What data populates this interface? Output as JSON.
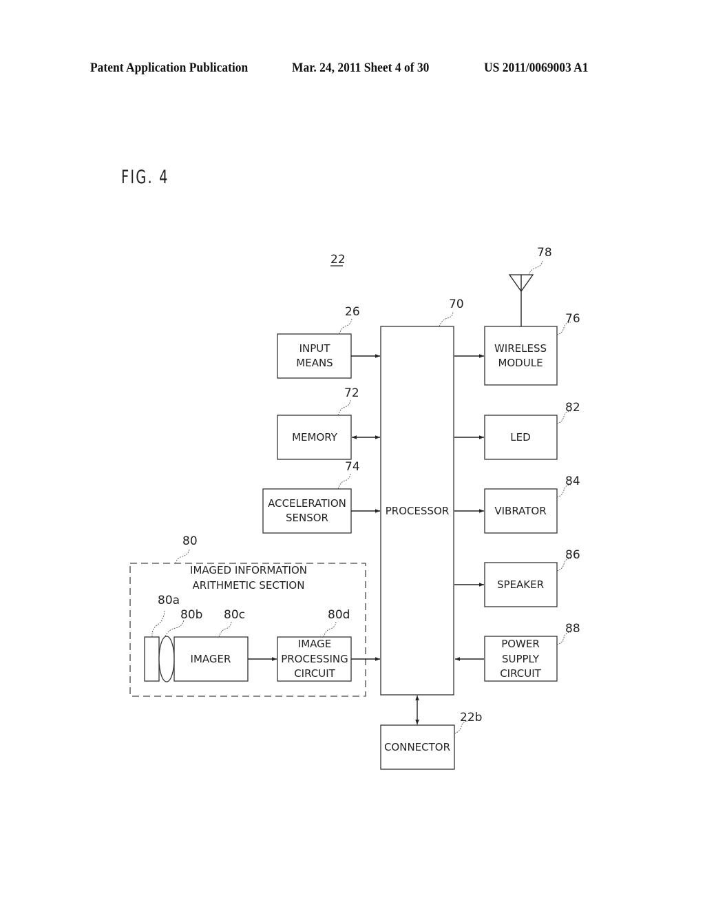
{
  "header": {
    "publication": "Patent Application Publication",
    "date_sheet": "Mar. 24, 2011  Sheet 4 of 30",
    "patent_number": "US 2011/0069003 A1"
  },
  "figure": {
    "title": "FIG. 4",
    "device_ref": "22"
  },
  "blocks": {
    "input_means": {
      "lines": [
        "INPUT",
        "MEANS"
      ],
      "ref": "26"
    },
    "memory": {
      "lines": [
        "MEMORY"
      ],
      "ref": "72"
    },
    "acceleration_sensor": {
      "lines": [
        "ACCELERATION",
        "SENSOR"
      ],
      "ref": "74"
    },
    "processor": {
      "lines": [
        "PROCESSOR"
      ],
      "ref": "70"
    },
    "wireless_module": {
      "lines": [
        "WIRELESS",
        "MODULE"
      ],
      "ref": "76"
    },
    "antenna": {
      "ref": "78"
    },
    "led": {
      "lines": [
        "LED"
      ],
      "ref": "82"
    },
    "vibrator": {
      "lines": [
        "VIBRATOR"
      ],
      "ref": "84"
    },
    "speaker": {
      "lines": [
        "SPEAKER"
      ],
      "ref": "86"
    },
    "power_supply_circuit": {
      "lines": [
        "POWER",
        "SUPPLY",
        "CIRCUIT"
      ],
      "ref": "88"
    },
    "connector": {
      "lines": [
        "CONNECTOR"
      ],
      "ref": "22b"
    },
    "imaged_info_section": {
      "lines": [
        "IMAGED INFORMATION",
        "ARITHMETIC SECTION"
      ],
      "ref": "80"
    },
    "filter": {
      "ref": "80a"
    },
    "lens": {
      "ref": "80b"
    },
    "imager": {
      "lines": [
        "IMAGER"
      ],
      "ref": "80c"
    },
    "image_processing_circuit": {
      "lines": [
        "IMAGE",
        "PROCESSING",
        "CIRCUIT"
      ],
      "ref": "80d"
    }
  },
  "connections": [
    {
      "from": "input_means",
      "to": "processor",
      "direction": "one-way"
    },
    {
      "from": "memory",
      "to": "processor",
      "direction": "two-way"
    },
    {
      "from": "acceleration_sensor",
      "to": "processor",
      "direction": "one-way"
    },
    {
      "from": "image_processing_circuit",
      "to": "processor",
      "direction": "one-way"
    },
    {
      "from": "imager",
      "to": "image_processing_circuit",
      "direction": "one-way"
    },
    {
      "from": "processor",
      "to": "wireless_module",
      "direction": "one-way"
    },
    {
      "from": "processor",
      "to": "led",
      "direction": "one-way"
    },
    {
      "from": "processor",
      "to": "vibrator",
      "direction": "one-way"
    },
    {
      "from": "processor",
      "to": "speaker",
      "direction": "one-way"
    },
    {
      "from": "power_supply_circuit",
      "to": "processor",
      "direction": "one-way"
    },
    {
      "from": "processor",
      "to": "connector",
      "direction": "two-way"
    },
    {
      "from": "antenna",
      "to": "wireless_module",
      "direction": "link"
    }
  ]
}
